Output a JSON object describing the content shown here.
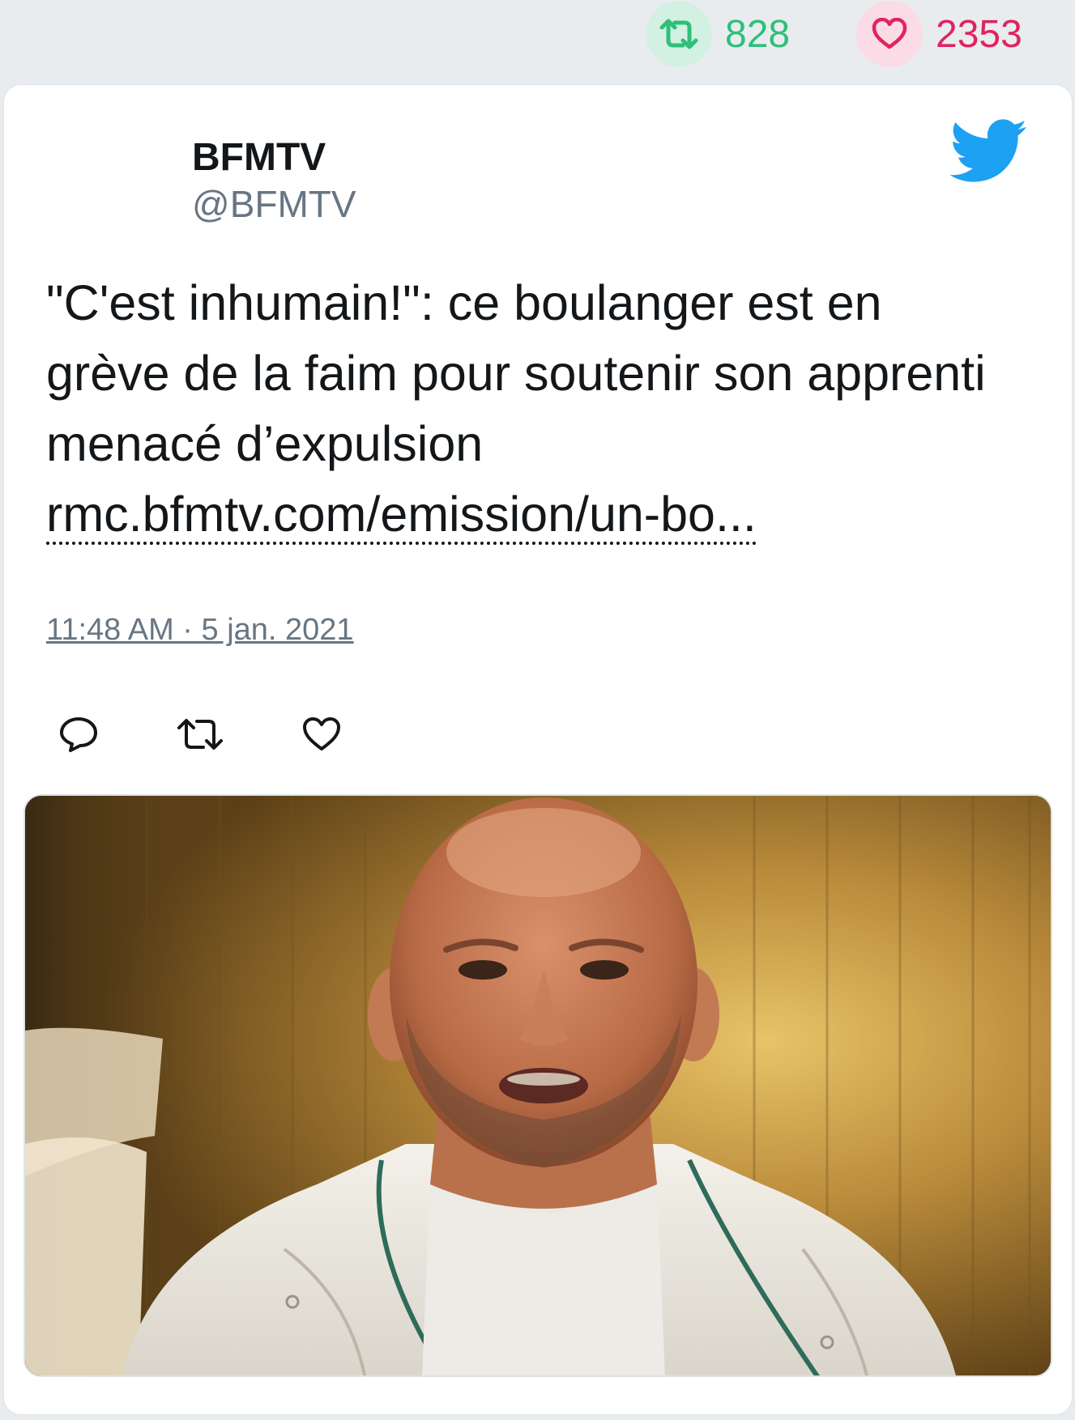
{
  "stats": {
    "retweets": "828",
    "likes": "2353",
    "retweet_icon": "retweet-icon",
    "like_icon": "heart-icon"
  },
  "tweet": {
    "author_name": "BFMTV",
    "author_handle": "@BFMTV",
    "text": "\"C'est inhumain!\": ce boulanger est en grève de la faim pour soutenir son apprenti menacé d’expulsion",
    "link_text": "rmc.bfmtv.com/emission/un-bo...",
    "timestamp": "11:48 AM · 5 jan. 2021",
    "actions": [
      "reply-icon",
      "retweet-icon",
      "heart-icon"
    ]
  },
  "colors": {
    "retweet_green": "#2fbf7a",
    "like_pink": "#e0245e",
    "twitter_blue": "#1da1f2",
    "text_dark": "#14171a",
    "text_gray": "#687683",
    "background": "#e9ecef"
  },
  "media": {
    "type": "photo",
    "subject": "man-in-white-chef-jacket"
  }
}
